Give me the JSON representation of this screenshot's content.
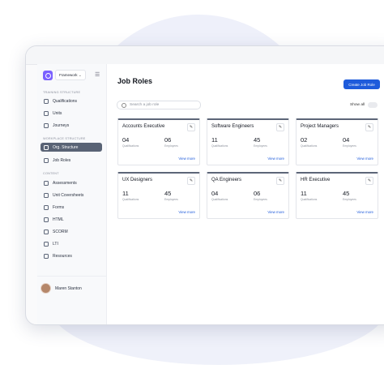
{
  "sidebar": {
    "framework_label": "Framework",
    "sections": {
      "training": "TRAINING STRUCTURE",
      "workplace": "WORKPLACE STRUCTURE",
      "content": "CONTENT"
    },
    "items": {
      "qualifications": "Qualifications",
      "units": "Units",
      "journeys": "Journeys",
      "org_structure": "Org. Structure",
      "job_roles": "Job Roles",
      "assessments": "Assessments",
      "unit_coversheets": "Unit Coversheets",
      "forms": "Forms",
      "html": "HTML",
      "scorm": "SCORM",
      "lti": "LTI",
      "resources": "Resources"
    },
    "user_name": "Maren Stanton"
  },
  "main": {
    "title": "Job Roles",
    "create_button": "Create Job Role",
    "search_placeholder": "Search a job role",
    "show_all": "Show all",
    "qualifications_label": "Qualifications",
    "employees_label": "Employees",
    "view_more": "View more",
    "cards": [
      {
        "name": "Accounts Executive",
        "qualifications": "04",
        "employees": "06"
      },
      {
        "name": "Software Engineers",
        "qualifications": "11",
        "employees": "45"
      },
      {
        "name": "Project Managers",
        "qualifications": "02",
        "employees": "04"
      },
      {
        "name": "UX Designers",
        "qualifications": "11",
        "employees": "45"
      },
      {
        "name": "QA Engineers",
        "qualifications": "04",
        "employees": "06"
      },
      {
        "name": "HR Executive",
        "qualifications": "11",
        "employees": "45"
      }
    ]
  },
  "colors": {
    "accent": "#1e5bdb",
    "logo": "#7b61ff",
    "active_nav": "#596375"
  }
}
